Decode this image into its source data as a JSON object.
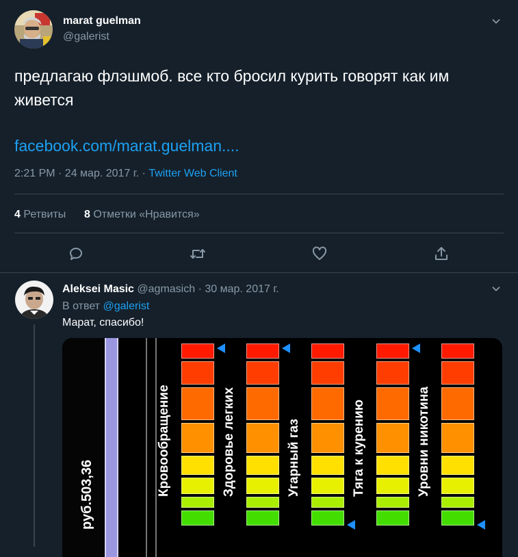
{
  "tweet": {
    "display_name": "marat guelman",
    "handle": "@galerist",
    "text": "предлагаю флэшмоб. все кто бросил курить говорят как им живется",
    "link": "facebook.com/marat.guelman....",
    "time": "2:21 PM · 24 мар. 2017 г.",
    "dot": " · ",
    "source": "Twitter Web Client",
    "retweets_count": "4",
    "retweets_label": "Ретвиты",
    "likes_count": "8",
    "likes_label": "Отметки «Нравится»"
  },
  "reply": {
    "display_name": "Aleksei Masic",
    "handle": "@agmasich",
    "sep": "·",
    "date": "30 мар. 2017 г.",
    "in_reply_prefix": "В ответ",
    "in_reply_handle": "@galerist",
    "text": "Марат, спасибо!",
    "image": {
      "money_label": "руб.503,36",
      "meters": [
        {
          "label": "Кровообращение",
          "marker": "top"
        },
        {
          "label": "Здоровье легких",
          "marker": "top"
        },
        {
          "label": "Угарный газ",
          "marker": "bottom"
        },
        {
          "label": "Тяга к курению",
          "marker": "top"
        },
        {
          "label": "Уровни никотина",
          "marker": "bottom"
        }
      ],
      "segment_colors": [
        "#ff1a00",
        "#ff3d00",
        "#ff6a00",
        "#ff9000",
        "#ffbb00",
        "#ffe000",
        "#e7f000",
        "#aaee00",
        "#44dd00"
      ],
      "marker_color": "#1e90ff"
    }
  }
}
